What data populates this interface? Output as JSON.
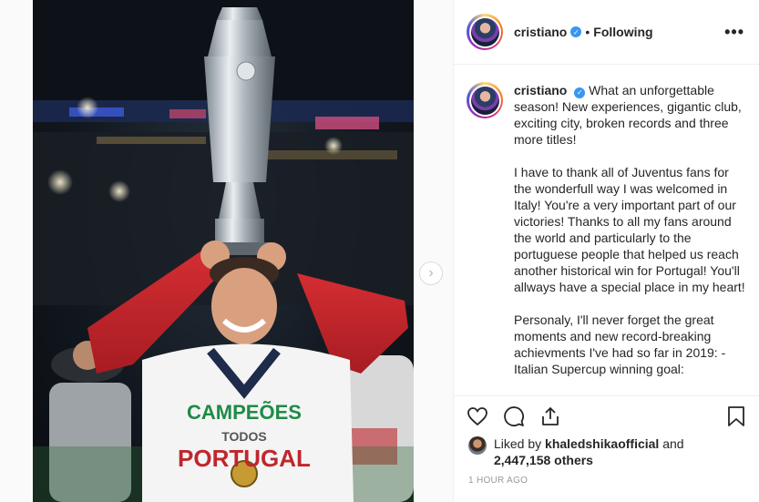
{
  "post": {
    "username": "cristiano",
    "verified_glyph": "✓",
    "separator": "•",
    "follow_status": "Following",
    "more_glyph": "•••"
  },
  "caption": {
    "username": "cristiano",
    "text": "What an unforgettable season! New experiences, gigantic club, exciting city, broken records and three more titles!\n\nI have to thank all of Juventus fans for the wonderfull way I was welcomed in Italy! You're a very important part of our victories! Thanks to all my fans around the world and particularly to the portuguese people that helped us reach another historical win for Portugal! You'll allways have a special place in my heart!\n\nPersonaly, I'll never forget the great moments and new record-breaking achievments I've had so far in 2019: - Italian Supercup winning goal:"
  },
  "likes": {
    "prefix": "Liked by",
    "liker": "khaledshikaofficial",
    "and": "and",
    "count": "2,447,158 others"
  },
  "timestamp": "1 hour ago",
  "photo": {
    "shirt_text_1": "CAMPEÕES",
    "shirt_text_2": "TODOS",
    "shirt_text_3": "PORTUGAL"
  },
  "carousel": {
    "next_glyph": "›"
  },
  "icons": {
    "like": "heart-icon",
    "comment": "comment-icon",
    "share": "share-icon",
    "save": "bookmark-icon",
    "more": "more-options-icon",
    "next": "chevron-right-icon"
  },
  "colors": {
    "verified_blue": "#3897f0",
    "border": "#efefef",
    "muted_text": "#999999",
    "sleeve_red": "#c8262c"
  }
}
